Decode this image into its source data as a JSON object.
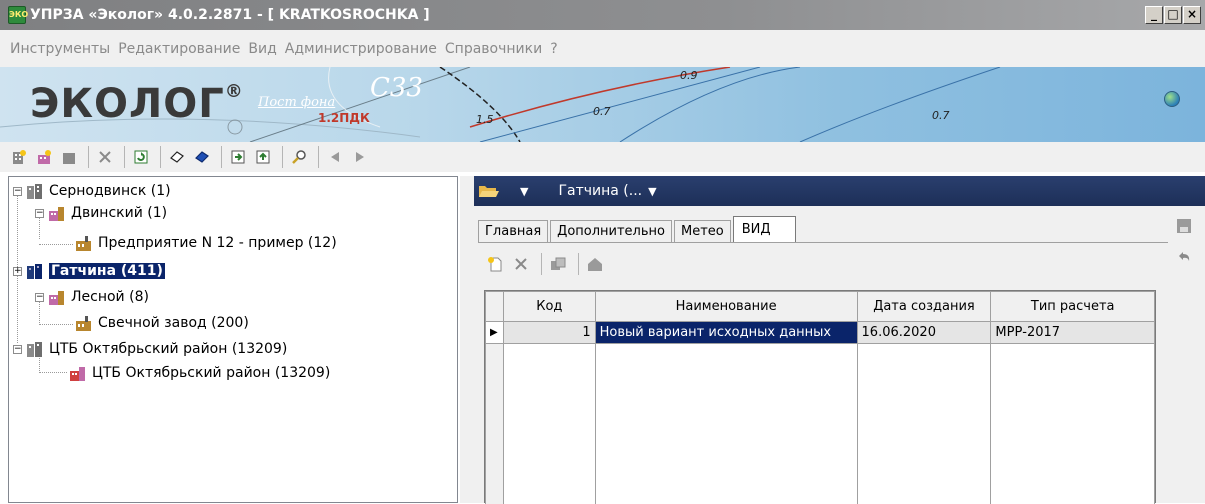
{
  "window": {
    "title": "УПРЗА «Эколог» 4.0.2.2871 - [ KRATKOSROCHKA ]",
    "app_icon_text": "ЭКО",
    "minimize": "_",
    "maximize": "□",
    "close": "×"
  },
  "menu": [
    "Инструменты",
    "Редактирование",
    "Вид",
    "Администрирование",
    "Справочники",
    "?"
  ],
  "banner": {
    "logo": "ЭКОЛОГ",
    "logo_mark": "®",
    "postfona": "Пост фона",
    "s33": "С33",
    "pdk": "1.2ПДК",
    "map_label_15": "1.5",
    "map_label_07": "0.7",
    "map_label_07b": "0.7",
    "map_label_09": "0.9"
  },
  "toolbar_icons": [
    "add-city-icon",
    "add-district-icon",
    "add-enterprise-icon",
    "delete-icon",
    "refresh-icon",
    "open-book-icon",
    "book-icon",
    "import-icon",
    "export-icon",
    "search-icon",
    "back-arrow-icon",
    "forward-arrow-icon"
  ],
  "tree": [
    {
      "label": "Сернодвинск (1)",
      "level": 0,
      "expander": "−"
    },
    {
      "label": "Двинский (1)",
      "level": 1,
      "expander": "−"
    },
    {
      "label": "Предприятие N 12 - пример (12)",
      "level": 2,
      "expander": ""
    },
    {
      "label": "Гатчина (411)",
      "level": 0,
      "expander": "+",
      "selected": true
    },
    {
      "label": "Лесной (8)",
      "level": 1,
      "expander": "−"
    },
    {
      "label": "Свечной завод (200)",
      "level": 2,
      "expander": ""
    },
    {
      "label": "ЦТБ Октябрьский район (13209)",
      "level": 0,
      "expander": "−"
    },
    {
      "label": "ЦТБ Октябрьский район (13209)",
      "level": 1,
      "expander": ""
    }
  ],
  "right_header": {
    "title": "Гатчина (...",
    "dropdown_arrow": "▼"
  },
  "tabs": [
    "Главная",
    "Дополнительно",
    "Метео",
    "ВИД"
  ],
  "active_tab": "ВИД",
  "grid": {
    "columns": [
      "Код",
      "Наименование",
      "Дата создания",
      "Тип расчета"
    ],
    "rows": [
      {
        "code": "1",
        "name": "Новый вариант исходных данных",
        "date": "16.06.2020",
        "type": "МРР-2017"
      }
    ]
  }
}
